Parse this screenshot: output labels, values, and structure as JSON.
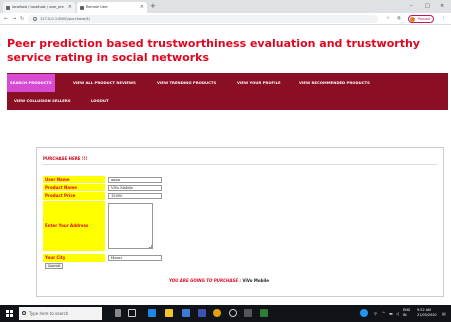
{
  "browser": {
    "tabs": [
      {
        "label": "localhost / localhost / user_pre",
        "active": false
      },
      {
        "label": "Remote User",
        "active": true
      }
    ],
    "new_tab": "+",
    "window_controls": [
      "–",
      "□",
      "×"
    ],
    "url": "127.0.0.1:8000/purchase/4/",
    "profile_label": "Paused"
  },
  "page": {
    "title": "Peer prediction based trustworthiness evaluation and trustworthy service rating in social networks"
  },
  "menu": {
    "active_color": "#d64bd1",
    "bar_color": "#8b0f24",
    "items": [
      {
        "label": "SEARCH PRODUCTS",
        "active": true
      },
      {
        "label": "VIEW ALL PRODUCT REVIEWS",
        "active": false
      },
      {
        "label": "VIEW TRENDING PRODUCTS",
        "active": false
      },
      {
        "label": "VIEW YOUR PROFILE",
        "active": false
      },
      {
        "label": "VIEW RECOMMENDED PRODUCTS",
        "active": false
      },
      {
        "label": "VIEW COLLUSION SELLERS",
        "active": false
      },
      {
        "label": "LOGOUT",
        "active": false
      }
    ]
  },
  "form": {
    "heading": "PURCHASE HERE !!!",
    "user_name_label": "User Name",
    "user_name_value": "anan",
    "product_name_label": "Product Name",
    "product_name_value": "ViVo Mobile",
    "product_price_label": "Product Price",
    "product_price_value": "15000",
    "address_label": "Enter Your Address",
    "city_label": "Your City",
    "city_value": "Hosur",
    "submit_label": "Submit",
    "going_prefix": "YOU ARE GOING TO PURCHASE :",
    "going_product": "ViVo Mobile"
  },
  "taskbar": {
    "search_placeholder": "Type here to search",
    "lang": "ENG",
    "lang_region": "IN",
    "time": "9:52 AM",
    "date": "21/05/2020"
  }
}
